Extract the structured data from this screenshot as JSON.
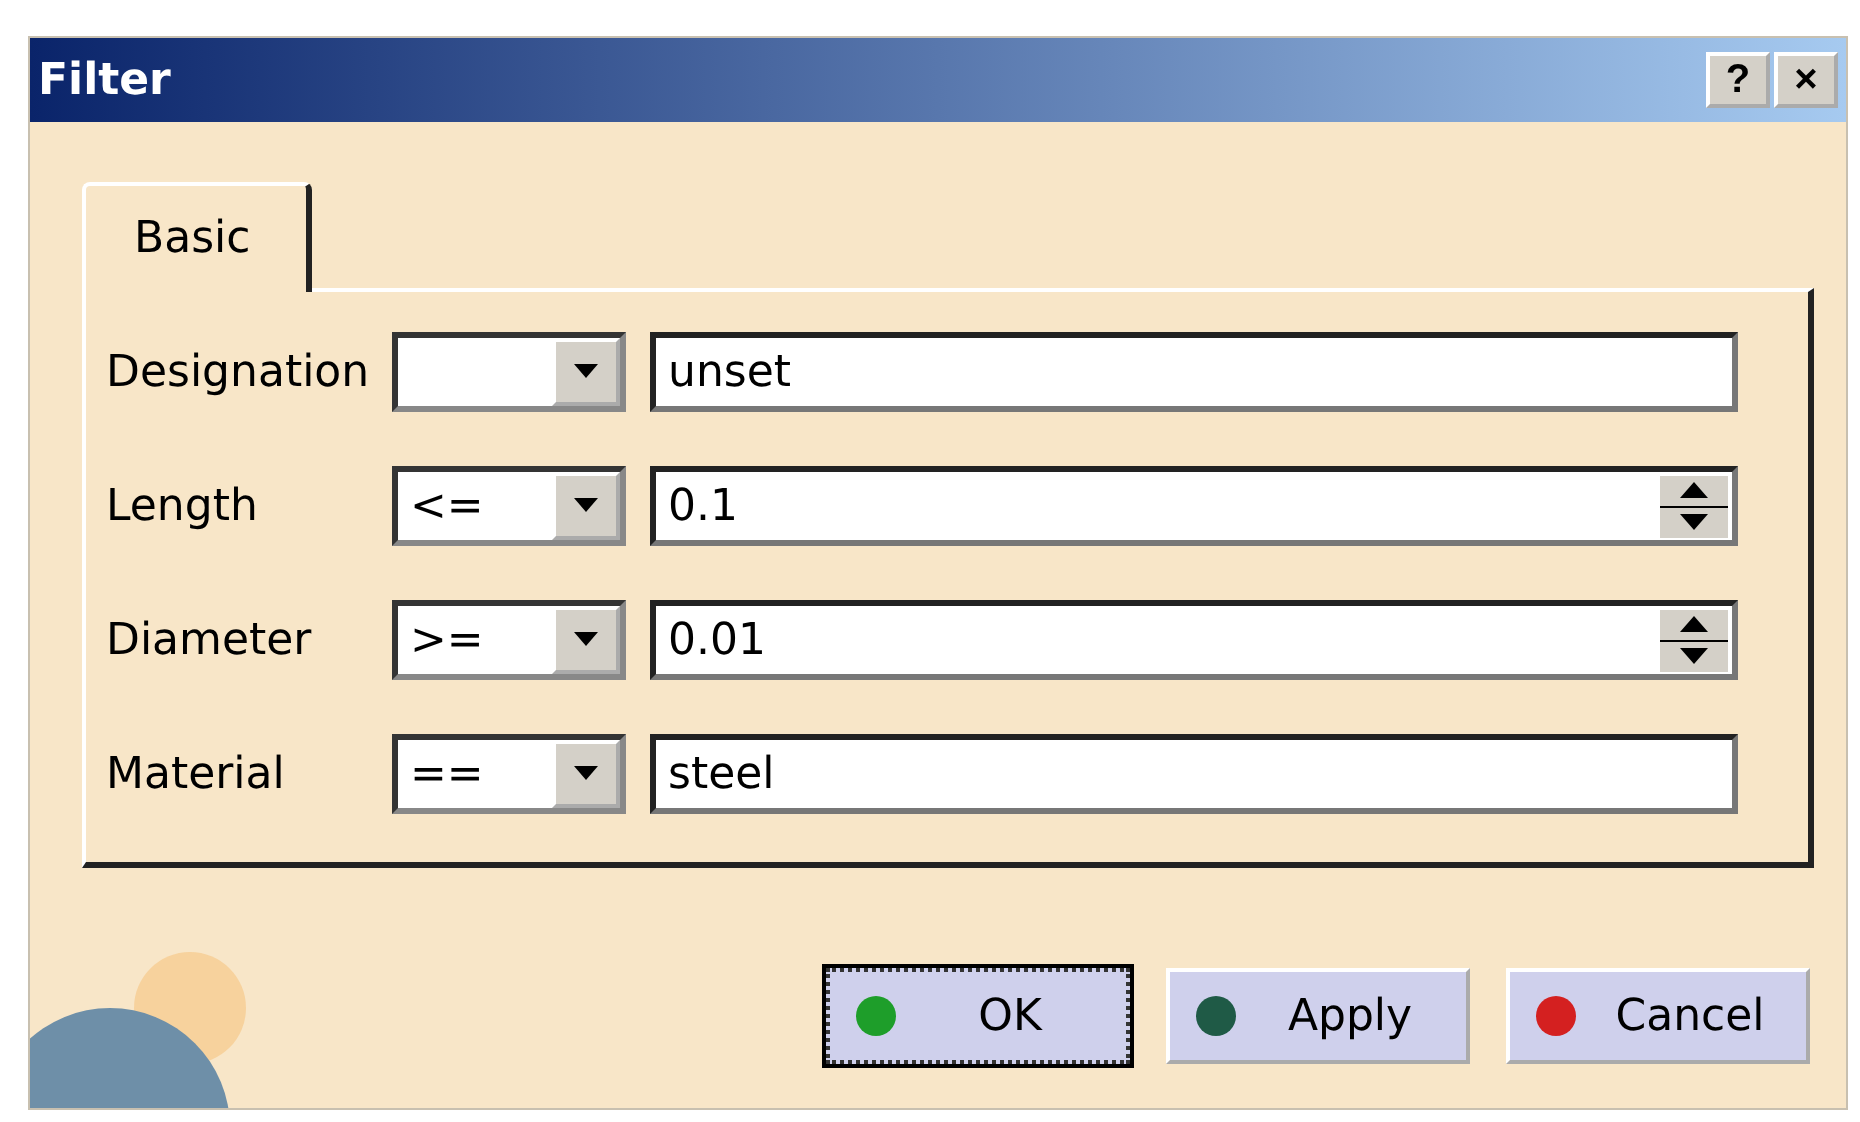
{
  "window": {
    "title": "Filter",
    "help_button": "?",
    "close_button": "×"
  },
  "tabs": [
    {
      "label": "Basic",
      "selected": true
    }
  ],
  "rows": [
    {
      "label": "Designation",
      "operator": "",
      "kind": "text",
      "value": "unset"
    },
    {
      "label": "Length",
      "operator": "<=",
      "kind": "spin",
      "value": "0.1"
    },
    {
      "label": "Diameter",
      "operator": ">=",
      "kind": "spin",
      "value": "0.01"
    },
    {
      "label": "Material",
      "operator": "==",
      "kind": "text",
      "value": "steel"
    }
  ],
  "buttons": [
    {
      "label": "OK",
      "color": "#1e9e2a",
      "selected": true
    },
    {
      "label": "Apply",
      "color": "#1f5a46",
      "selected": false
    },
    {
      "label": "Cancel",
      "color": "#d42020",
      "selected": false
    }
  ]
}
